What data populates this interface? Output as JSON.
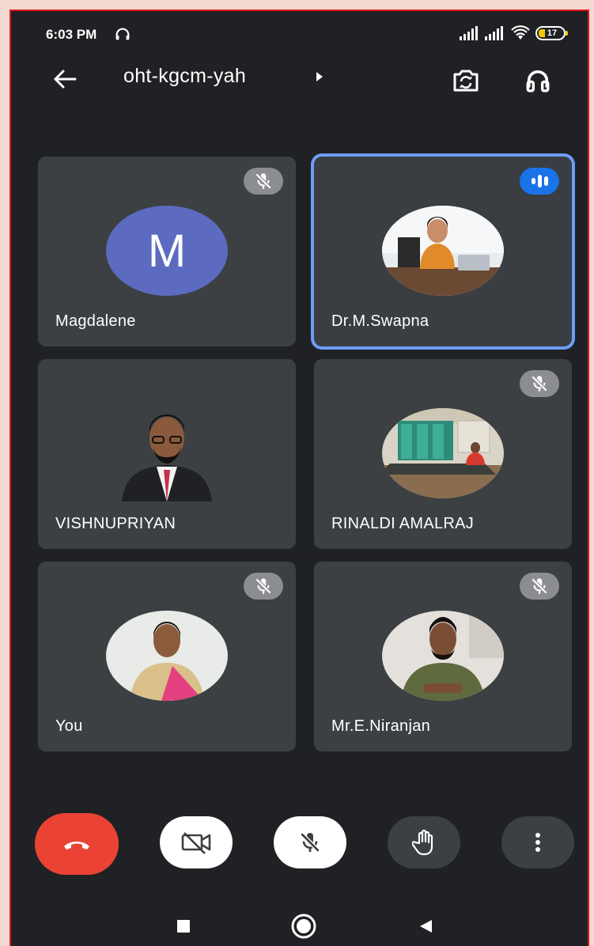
{
  "status_bar": {
    "time": "6:03 PM",
    "battery": "17"
  },
  "top_bar": {
    "meeting_code": "oht-kgcm-yah"
  },
  "participants": [
    {
      "name": "Magdalene",
      "initial": "M",
      "muted": true,
      "speaking": false
    },
    {
      "name": "Dr.M.Swapna",
      "muted": false,
      "speaking": true
    },
    {
      "name": "VISHNUPRIYAN",
      "muted": false,
      "speaking": false
    },
    {
      "name": "RINALDI AMALRAJ",
      "muted": true,
      "speaking": false
    },
    {
      "name": "You",
      "muted": true,
      "speaking": false
    },
    {
      "name": "Mr.E.Niranjan",
      "muted": true,
      "speaking": false
    }
  ],
  "colors": {
    "background": "#202124",
    "tile": "#3c4043",
    "speaking_outline": "#6c9ef7",
    "end_call": "#ea4335",
    "avatar_m": "#5c6bc0"
  },
  "icons": [
    "back-arrow-icon",
    "caret-right-icon",
    "switch-camera-icon",
    "headphones-icon",
    "mic-off-icon",
    "audio-level-icon",
    "end-call-icon",
    "camera-off-icon",
    "raise-hand-icon",
    "more-vert-icon",
    "recents-icon",
    "home-icon",
    "back-icon"
  ]
}
